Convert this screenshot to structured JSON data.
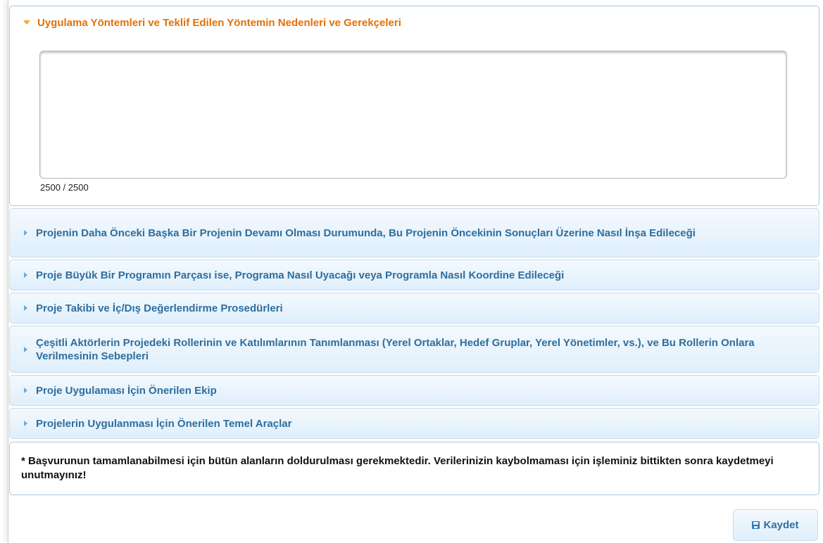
{
  "open_section": {
    "title": "Uygulama Yöntemleri ve Teklif Edilen Yöntemin Nedenleri ve Gerekçeleri",
    "textarea_value": "",
    "char_counter": "2500 / 2500"
  },
  "sections": [
    {
      "title": "Projenin Daha Önceki Başka Bir Projenin Devamı Olması Durumunda, Bu Projenin Öncekinin Sonuçları Üzerine Nasıl İnşa Edileceği"
    },
    {
      "title": "Proje Büyük Bir Programın Parçası ise, Programa Nasıl Uyacağı veya Programla Nasıl Koordine Edileceği"
    },
    {
      "title": "Proje Takibi ve İç/Dış Değerlendirme Prosedürleri"
    },
    {
      "title": "Çeşitli Aktörlerin Projedeki Rollerinin ve Katılımlarının Tanımlanması (Yerel Ortaklar, Hedef Gruplar, Yerel Yönetimler, vs.), ve Bu Rollerin Onlara Verilmesinin Sebepleri"
    },
    {
      "title": "Proje Uygulaması İçin Önerilen Ekip"
    },
    {
      "title": "Projelerin Uygulanması İçin Önerilen Temel Araçlar"
    }
  ],
  "note": "* Başvurunun tamamlanabilmesi için bütün alanların doldurulması gerekmektedir. Verilerinizin kaybolmaması için işleminiz bittikten sonra kaydetmeyi unutmayınız!",
  "save_button": {
    "label": "Kaydet",
    "icon": "floppy-disk-icon"
  },
  "colors": {
    "active_header": "#e17009",
    "collapsed_header": "#2e6e9e",
    "border": "#a6c9e2"
  }
}
